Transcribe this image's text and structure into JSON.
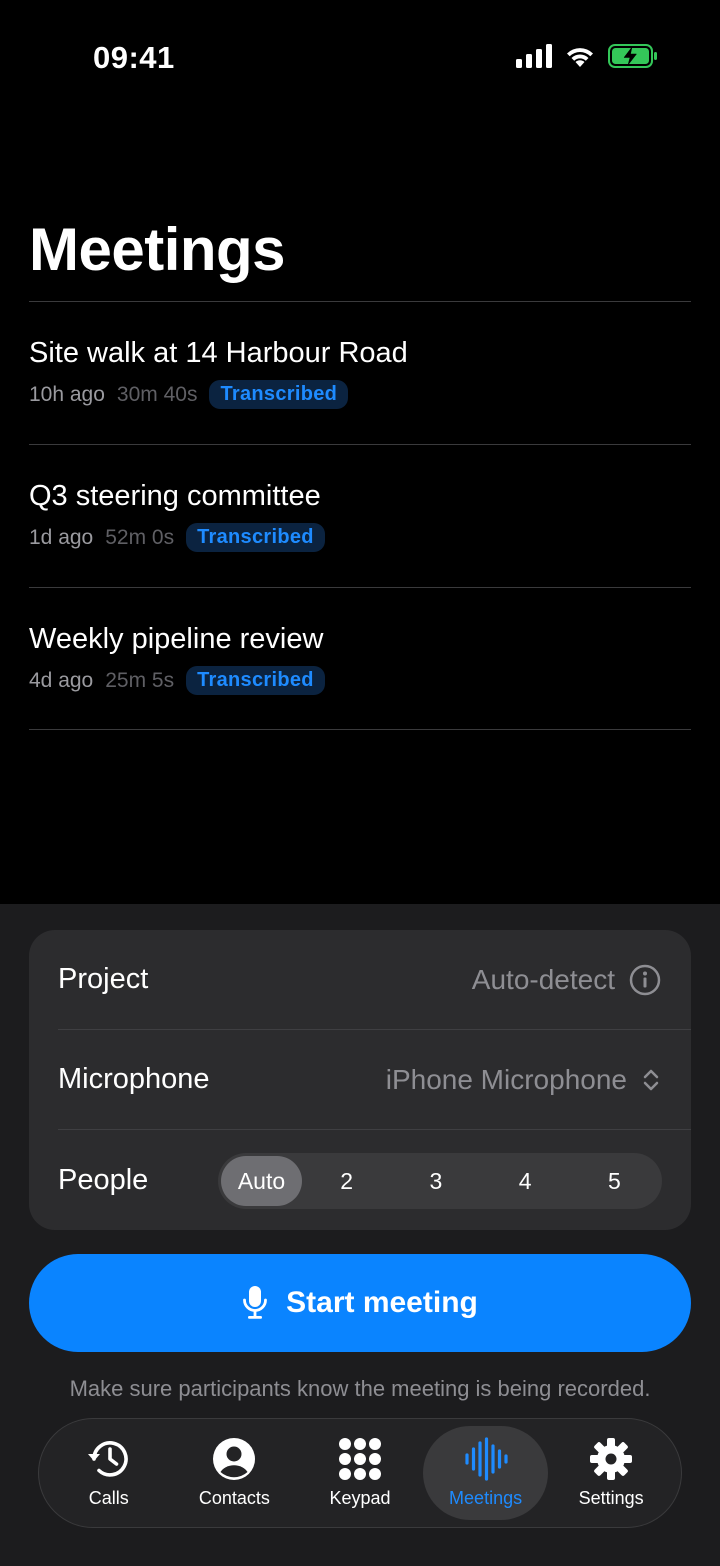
{
  "status_bar": {
    "time": "09:41"
  },
  "page": {
    "title": "Meetings"
  },
  "meetings": [
    {
      "title": "Site walk at 14 Harbour Road",
      "age": "10h ago",
      "duration": "30m 40s",
      "status": "Transcribed"
    },
    {
      "title": "Q3 steering committee",
      "age": "1d ago",
      "duration": "52m 0s",
      "status": "Transcribed"
    },
    {
      "title": "Weekly pipeline review",
      "age": "4d ago",
      "duration": "25m 5s",
      "status": "Transcribed"
    }
  ],
  "settings": {
    "project": {
      "label": "Project",
      "value": "Auto-detect",
      "icon": "info-icon"
    },
    "microphone": {
      "label": "Microphone",
      "value": "iPhone Microphone",
      "icon": "chevron-up-down-icon"
    },
    "people": {
      "label": "People",
      "options": [
        "Auto",
        "2",
        "3",
        "4",
        "5"
      ],
      "selected": "Auto"
    }
  },
  "start_button": {
    "label": "Start meeting",
    "icon": "microphone-icon"
  },
  "notice": "Make sure participants know the meeting is being recorded.",
  "tabs": [
    {
      "label": "Calls",
      "icon": "clock-history-icon"
    },
    {
      "label": "Contacts",
      "icon": "person-circle-icon"
    },
    {
      "label": "Keypad",
      "icon": "keypad-icon"
    },
    {
      "label": "Meetings",
      "icon": "waveform-icon",
      "active": true
    },
    {
      "label": "Settings",
      "icon": "gear-icon"
    }
  ],
  "colors": {
    "accent": "#0a84ff",
    "badge_text": "#1e8bff",
    "badge_bg": "#0b2340",
    "battery": "#34c759"
  }
}
